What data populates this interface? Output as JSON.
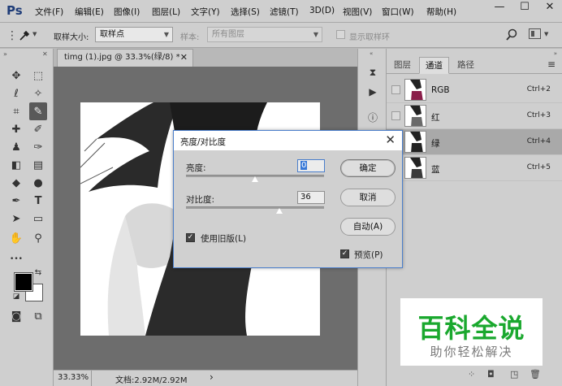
{
  "app": {
    "logo": "Ps"
  },
  "menu": [
    "文件(F)",
    "编辑(E)",
    "图像(I)",
    "图层(L)",
    "文字(Y)",
    "选择(S)",
    "滤镜(T)",
    "3D(D)",
    "视图(V)",
    "窗口(W)",
    "帮助(H)"
  ],
  "window_controls": {
    "minimize": "—",
    "maximize": "☐",
    "close": "✕"
  },
  "options": {
    "sample_size_label": "取样大小:",
    "sample_size_value": "取样点",
    "sample_label": "样本:",
    "sample_value": "所有图层",
    "show_ring_label": "显示取样环"
  },
  "tools": {
    "move": "✥",
    "marquee": "⬚",
    "lasso": "ℓ",
    "wand": "✧",
    "crop": "⌗",
    "eyedropper": "✎",
    "heal": "✚",
    "brush": "✐",
    "stamp": "♟",
    "history_brush": "✑",
    "eraser": "◧",
    "gradient": "▤",
    "blur": "◆",
    "dodge": "●",
    "pen": "✒",
    "type": "T",
    "select_arrow": "➤",
    "rect_shape": "▭",
    "hand": "✋",
    "zoom": "⚲",
    "more": "•••",
    "swap": "⇆",
    "default_colors": "◪",
    "quick_mask": "◙",
    "screen_mode": "⧉"
  },
  "colors": {
    "foreground": "#000000",
    "background": "#ffffff",
    "accent": "#4a7ecb",
    "watermark_green": "#1aa82e"
  },
  "document": {
    "tab_title": "timg (1).jpg @ 33.3%(绿/8) *",
    "close": "✕"
  },
  "status": {
    "zoom": "33.33%",
    "doc_size": "文档:2.92M/2.92M",
    "arrow": "›"
  },
  "dock": {
    "history": "⧗",
    "actions": "▶",
    "info": "ⓘ"
  },
  "panel": {
    "tabs": [
      "图层",
      "通道",
      "路径"
    ],
    "menu_icon": "≡",
    "channels": [
      {
        "name": "RGB",
        "shortcut": "Ctrl+2",
        "selected": false
      },
      {
        "name": "红",
        "shortcut": "Ctrl+3",
        "selected": false
      },
      {
        "name": "绿",
        "shortcut": "Ctrl+4",
        "selected": true
      },
      {
        "name": "蓝",
        "shortcut": "Ctrl+5",
        "selected": false
      }
    ],
    "footer_icons": [
      "⁘",
      "◘",
      "◳",
      "🗑"
    ]
  },
  "dialog": {
    "title": "亮度/对比度",
    "close": "✕",
    "brightness_label": "亮度:",
    "brightness_value": "0",
    "contrast_label": "对比度:",
    "contrast_value": "36",
    "legacy_label": "使用旧版(L)",
    "ok": "确定",
    "cancel": "取消",
    "auto": "自动(A)",
    "preview": "预览(P)",
    "check": "✓"
  },
  "watermark": {
    "title": "百科全说",
    "subtitle": "助你轻松解决"
  }
}
